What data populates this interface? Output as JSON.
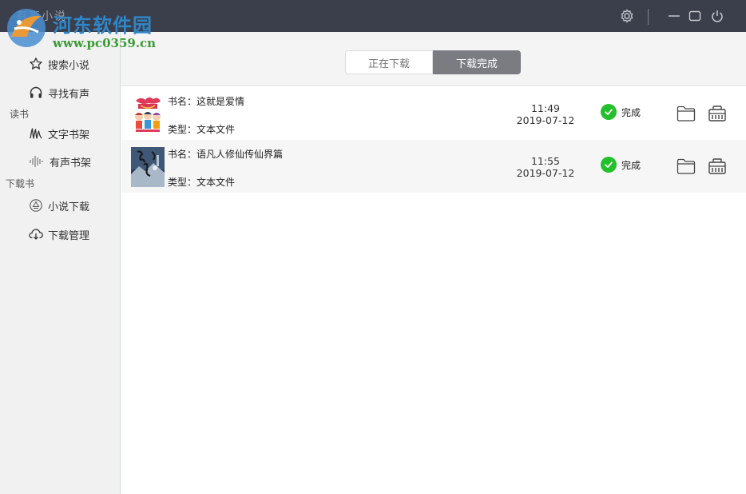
{
  "window": {
    "app_name": "有声小说",
    "watermark_brand": "河东软件园",
    "watermark_url": "www.pc0359.cn",
    "controls": [
      "settings-icon",
      "minimize-icon",
      "maximize-icon",
      "power-icon"
    ]
  },
  "sidebar": {
    "items": [
      {
        "label": "搜索小说",
        "icon": "star-icon"
      },
      {
        "label": "寻找有声",
        "icon": "headphones-icon"
      }
    ],
    "group_read": "读书",
    "read_items": [
      {
        "label": "文字书架",
        "icon": "text-shelf-icon"
      },
      {
        "label": "有声书架",
        "icon": "audio-wave-icon"
      }
    ],
    "group_download": "下载书",
    "download_items": [
      {
        "label": "小说下载",
        "icon": "download-circle-icon"
      },
      {
        "label": "下载管理",
        "icon": "cloud-download-icon"
      }
    ]
  },
  "tabs": {
    "downloading": "正在下载",
    "completed": "下载完成",
    "active": "completed"
  },
  "downloads": [
    {
      "name": "书名：这就是爱情",
      "type": "类型：文本文件",
      "time": "11:49",
      "date": "2019-07-12",
      "status": "完成"
    },
    {
      "name": "书名：语凡人修仙传仙界篇",
      "type": "类型：文本文件",
      "time": "11:55",
      "date": "2019-07-12",
      "status": "完成"
    }
  ],
  "colors": {
    "titlebar": "#3b3e4b",
    "sidebar": "#f1f1f1",
    "active_tab": "#7a7c82",
    "status_ok": "#22c12b"
  }
}
